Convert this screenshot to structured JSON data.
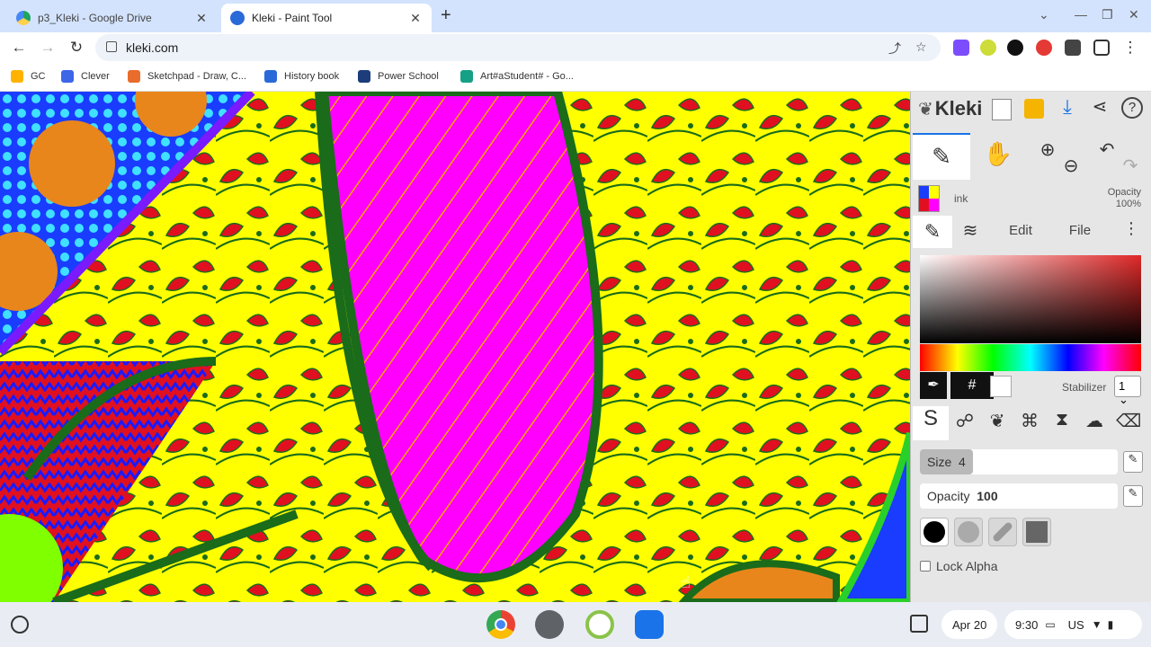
{
  "browser": {
    "tabs": [
      {
        "title": "p3_Kleki - Google Drive",
        "icon": "google-drive-icon",
        "active": false
      },
      {
        "title": "Kleki - Paint Tool",
        "icon": "kleki-icon",
        "active": true
      }
    ],
    "url": "kleki.com",
    "bookmarks": [
      {
        "label": "GC",
        "color": "#ffb300"
      },
      {
        "label": "Clever",
        "color": "#3c65e8"
      },
      {
        "label": "Sketchpad - Draw, C...",
        "color": "#e86c2c"
      },
      {
        "label": "History book",
        "color": "#2a6ad8"
      },
      {
        "label": "Power School",
        "color": "#1c3d7a"
      },
      {
        "label": "Art#aStudent# - Go...",
        "color": "#16a085"
      }
    ]
  },
  "kleki": {
    "logo": "Kleki",
    "brush_name": "ink",
    "opacity_label": "Opacity",
    "opacity_value": "100%",
    "tabs": [
      "Edit",
      "File"
    ],
    "stabilizer_label": "Stabilizer",
    "stabilizer_value": "1",
    "hash": "#",
    "size_label": "Size",
    "size_value": "4",
    "size_fraction": 0.27,
    "brush_opacity_label": "Opacity",
    "brush_opacity_value": "100",
    "lock_alpha_label": "Lock Alpha",
    "current_color": "#ffffff",
    "accent": "#1a73e8"
  },
  "shelf": {
    "date": "Apr 20",
    "time": "9:30",
    "locale": "US"
  }
}
